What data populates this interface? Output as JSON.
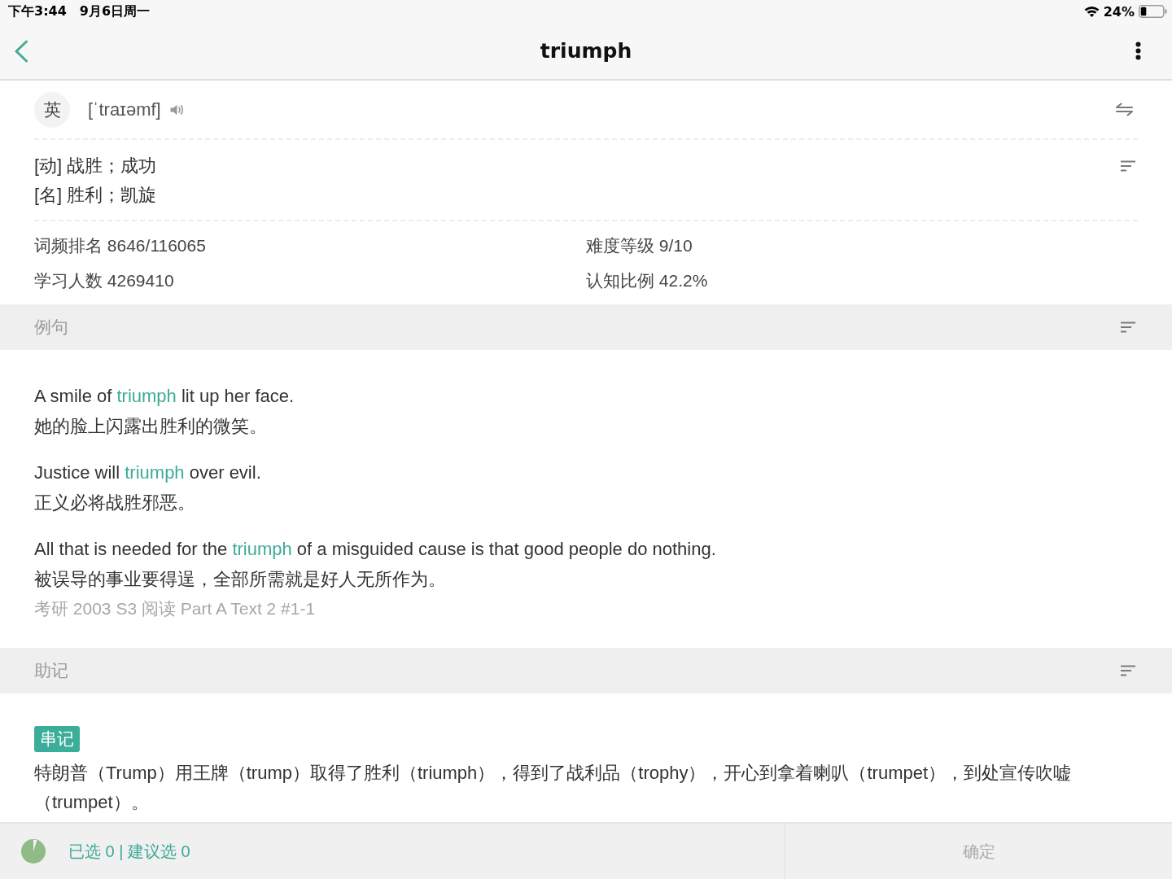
{
  "status_bar": {
    "time": "下午3:44",
    "date": "9月6日周一",
    "battery": "24%"
  },
  "nav_bar": {
    "title": "triumph"
  },
  "pronunciation": {
    "accent": "英",
    "phonetic": "[ˈtraɪəmf]"
  },
  "definitions": [
    "[动] 战胜；成功",
    "[名] 胜利；凯旋"
  ],
  "stats": [
    "词频排名 8646/116065",
    "难度等级 9/10",
    "学习人数 4269410",
    "认知比例 42.2%"
  ],
  "examples_section": {
    "title": "例句",
    "examples": [
      {
        "en": {
          "before": "A smile of ",
          "keyword": "triumph",
          "after": " lit up her face."
        },
        "zh": "她的脸上闪露出胜利的微笑。"
      },
      {
        "en": {
          "before": "Justice will ",
          "keyword": "triumph",
          "after": " over evil."
        },
        "zh": "正义必将战胜邪恶。"
      },
      {
        "en": {
          "before": "All that is needed for the ",
          "keyword": "triumph",
          "after": " of a misguided cause is that good people do nothing."
        },
        "zh": "被误导的事业要得逞，全部所需就是好人无所作为。",
        "source": "考研 2003 S3 阅读 Part A Text 2 #1-1"
      }
    ]
  },
  "mnemonic_section": {
    "title": "助记",
    "tag": "串记",
    "text": "特朗普（Trump）用王牌（trump）取得了胜利（triumph），得到了战利品（trophy），开心到拿着喇叭（trumpet），到处宣传吹嘘（trumpet）。"
  },
  "bottom_bar": {
    "selection": "已选 0 | 建议选 0",
    "confirm": {
      "label": "确定",
      "disabled": true
    }
  }
}
